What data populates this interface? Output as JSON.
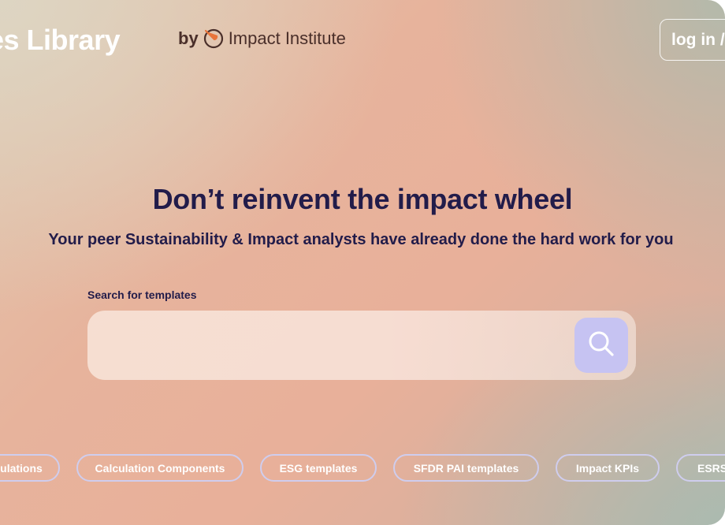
{
  "header": {
    "title": "ates Library",
    "by_text": "by",
    "org_name": "Impact Institute",
    "login_label": "log in /"
  },
  "hero": {
    "title": "Don’t reinvent the impact wheel",
    "subtitle": "Your peer Sustainability & Impact analysts have already done the hard work for you"
  },
  "search": {
    "label": "Search for templates",
    "value": "",
    "placeholder": ""
  },
  "chips": [
    "ulations",
    "Calculation Components",
    "ESG templates",
    "SFDR PAI templates",
    "Impact KPIs",
    "ESRS"
  ],
  "colors": {
    "heading": "#221c4a",
    "search_button": "#c6c3f2",
    "chip_border": "#cfcdee",
    "logo_orange": "#e8743b"
  },
  "icons": {
    "logo": "impact-institute-logo",
    "search": "search-icon"
  }
}
